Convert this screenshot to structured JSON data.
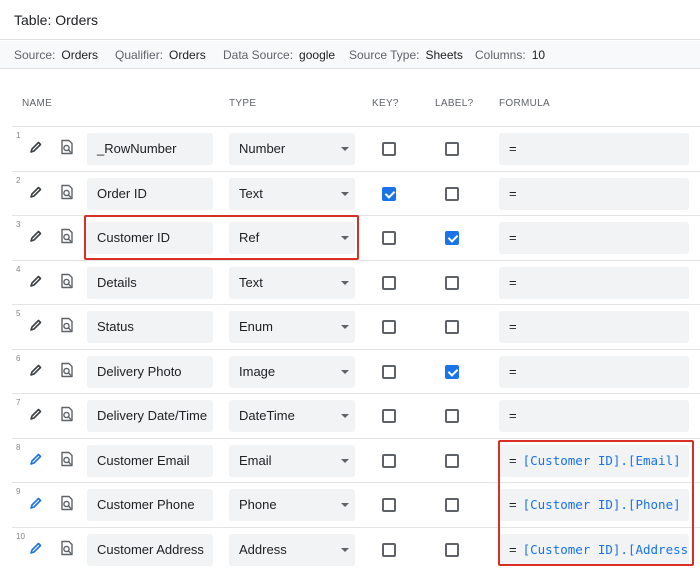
{
  "window": {
    "title": "Table: Orders"
  },
  "meta": {
    "source_label": "Source:",
    "source": "Orders",
    "qualifier_label": "Qualifier:",
    "qualifier": "Orders",
    "datasource_label": "Data Source:",
    "datasource": "google",
    "sourcetype_label": "Source Type:",
    "sourcetype": "Sheets",
    "columns_label": "Columns:",
    "columns": "10"
  },
  "headers": {
    "name": "NAME",
    "type": "TYPE",
    "key": "KEY?",
    "label": "LABEL?",
    "formula": "FORMULA"
  },
  "icons": {
    "edit": "pencil-icon",
    "view": "view-column-icon"
  },
  "colors": {
    "accent": "#1a73e8",
    "highlight": "#d93025"
  },
  "rows": [
    {
      "num": "1",
      "name": "_RowNumber",
      "type": "Number",
      "key": false,
      "label": false,
      "formula_eq": "=",
      "formula": ""
    },
    {
      "num": "2",
      "name": "Order ID",
      "type": "Text",
      "key": true,
      "label": false,
      "formula_eq": "=",
      "formula": ""
    },
    {
      "num": "3",
      "name": "Customer ID",
      "type": "Ref",
      "key": false,
      "label": true,
      "formula_eq": "=",
      "formula": ""
    },
    {
      "num": "4",
      "name": "Details",
      "type": "Text",
      "key": false,
      "label": false,
      "formula_eq": "=",
      "formula": ""
    },
    {
      "num": "5",
      "name": "Status",
      "type": "Enum",
      "key": false,
      "label": false,
      "formula_eq": "=",
      "formula": ""
    },
    {
      "num": "6",
      "name": "Delivery Photo",
      "type": "Image",
      "key": false,
      "label": true,
      "formula_eq": "=",
      "formula": ""
    },
    {
      "num": "7",
      "name": "Delivery Date/Time",
      "type": "DateTime",
      "key": false,
      "label": false,
      "formula_eq": "=",
      "formula": ""
    },
    {
      "num": "8",
      "name": "Customer Email",
      "type": "Email",
      "key": false,
      "label": false,
      "formula_eq": "=",
      "formula": "[Customer ID].[Email]"
    },
    {
      "num": "9",
      "name": "Customer Phone",
      "type": "Phone",
      "key": false,
      "label": false,
      "formula_eq": "=",
      "formula": "[Customer ID].[Phone]"
    },
    {
      "num": "10",
      "name": "Customer Address",
      "type": "Address",
      "key": false,
      "label": false,
      "formula_eq": "=",
      "formula": "[Customer ID].[Address]"
    }
  ]
}
